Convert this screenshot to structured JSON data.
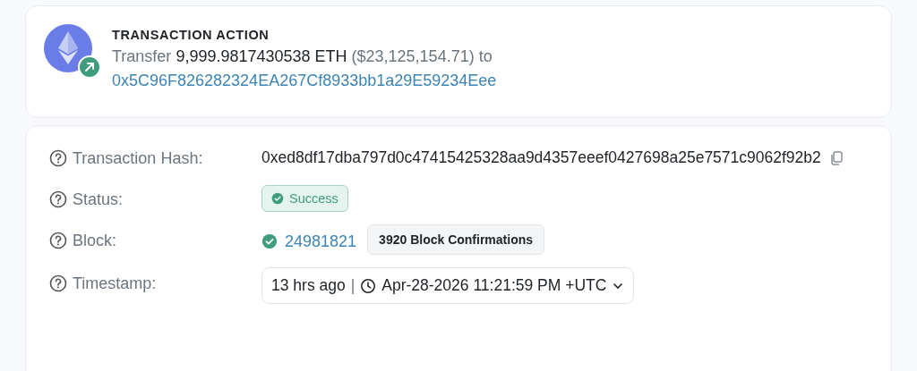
{
  "action": {
    "title": "TRANSACTION ACTION",
    "verb": "Transfer",
    "amount": "9,999.9817430538 ETH",
    "usd": "($23,125,154.71)",
    "to_word": "to",
    "address": "0x5C96F826282324EA267Cf8933bb1a29E59234Eee"
  },
  "details": [
    {
      "kind": "hash",
      "label": "Transaction Hash:",
      "value": "0xed8df17dba797d0c47415425328aa9d4357eeef0427698a25e7571c9062f92b2"
    },
    {
      "kind": "status",
      "label": "Status:",
      "value": "Success"
    },
    {
      "kind": "block",
      "label": "Block:",
      "value": "24981821",
      "badge": "3920 Block Confirmations"
    },
    {
      "kind": "timestamp",
      "label": "Timestamp:",
      "relative": "13 hrs ago",
      "separator": "|",
      "value": "Apr-28-2026 11:21:59 PM +UTC"
    }
  ]
}
